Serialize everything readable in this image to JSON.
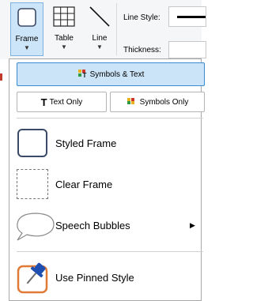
{
  "ribbon": {
    "frame_label": "Frame",
    "table_label": "Table",
    "line_label": "Line",
    "line_style_label": "Line Style:",
    "thickness_label": "Thickness:"
  },
  "menu": {
    "symbols_text_label": "Symbols & Text",
    "text_only_label": "Text Only",
    "symbols_only_label": "Symbols Only",
    "styled_frame_label": "Styled Frame",
    "clear_frame_label": "Clear Frame",
    "speech_bubbles_label": "Speech Bubbles",
    "use_pinned_style_label": "Use Pinned Style"
  },
  "colors": {
    "selected_bg": "#cce4f7",
    "selected_border": "#3a8ad6",
    "frame_stroke": "#3b4a66",
    "pinned_orange": "#e07a36",
    "pin_blue": "#1e4fb0"
  },
  "icons": {
    "frame": "frame-icon",
    "table": "table-icon",
    "line": "line-icon",
    "symbols_text": "symbols-text-icon",
    "text_only": "text-t-icon",
    "symbols_only": "symbols-icon",
    "styled_frame": "styled-frame-icon",
    "clear_frame": "clear-frame-icon",
    "speech_bubble": "speech-bubble-icon",
    "pin": "pin-icon",
    "submenu": "chevron-right-icon"
  }
}
